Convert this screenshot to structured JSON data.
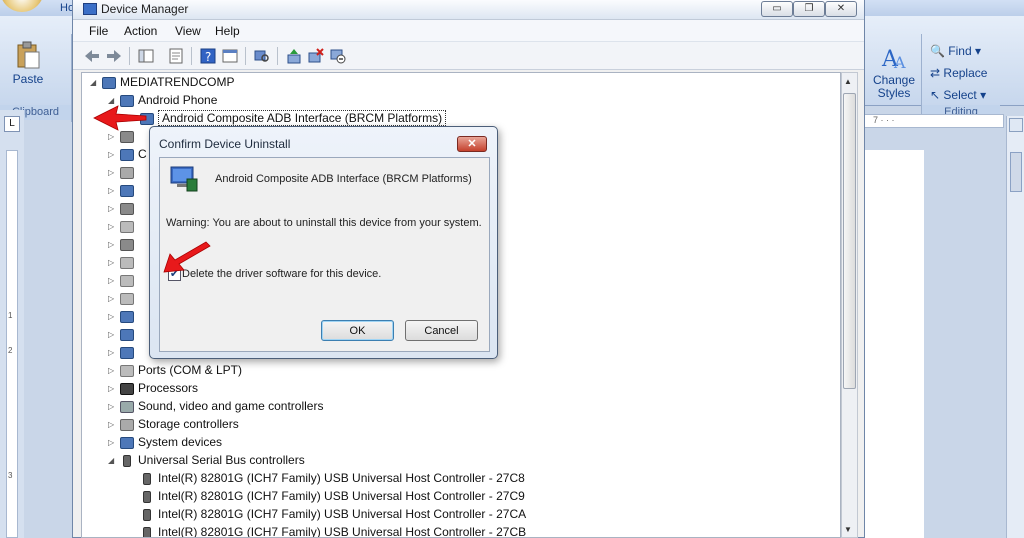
{
  "word": {
    "tab_partial": "Ho",
    "clipboard": {
      "paste": "Paste",
      "label": "Clipboard"
    },
    "styles": {
      "change": "Change",
      "styles": "Styles"
    },
    "editing": {
      "find": "Find ▾",
      "replace": "Replace",
      "select": "Select ▾",
      "label": "Editing"
    },
    "ruler_mark": "7 · · ·",
    "vruler_marks": [
      "1",
      "2",
      "3"
    ]
  },
  "device_manager": {
    "title": "Device Manager",
    "window_buttons": {
      "minimize": "▭",
      "restore": "❐",
      "close": "✕"
    },
    "menu": [
      "File",
      "Action",
      "View",
      "Help"
    ],
    "tree": {
      "root": "MEDIATRENDCOMP",
      "android_phone": "Android Phone",
      "adb_device": "Android Composite ADB Interface (BRCM Platforms)",
      "collapsed_partial": [
        "C"
      ],
      "ports": "Ports (COM & LPT)",
      "processors": "Processors",
      "sound": "Sound, video and game controllers",
      "storage": "Storage controllers",
      "system": "System devices",
      "usb": "Universal Serial Bus controllers",
      "usb_children": [
        "Intel(R) 82801G (ICH7 Family) USB Universal Host Controller - 27C8",
        "Intel(R) 82801G (ICH7 Family) USB Universal Host Controller - 27C9",
        "Intel(R) 82801G (ICH7 Family) USB Universal Host Controller - 27CA",
        "Intel(R) 82801G (ICH7 Family) USB Universal Host Controller - 27CB"
      ]
    }
  },
  "dialog": {
    "title": "Confirm Device Uninstall",
    "close": "✕",
    "device_name": "Android Composite ADB Interface (BRCM Platforms)",
    "warning": "Warning: You are about to uninstall this device from your system.",
    "checkbox_label": "Delete the driver software for this device.",
    "checkbox_checked": "✔",
    "ok": "OK",
    "cancel": "Cancel"
  },
  "colors": {
    "annotation_arrow": "#e8191b",
    "dialog_border": "#4b5e79",
    "word_ribbon": "#c7d7ed"
  },
  "icons": [
    "orb-icon",
    "paste-icon",
    "styles-icon",
    "find-icon",
    "replace-icon",
    "select-icon",
    "device-manager-icon",
    "back-icon",
    "forward-icon",
    "properties-icon",
    "help-icon",
    "scan-icon",
    "update-driver-icon",
    "uninstall-icon",
    "disable-icon",
    "computer-icon",
    "usb-icon",
    "warning-device-icon"
  ]
}
